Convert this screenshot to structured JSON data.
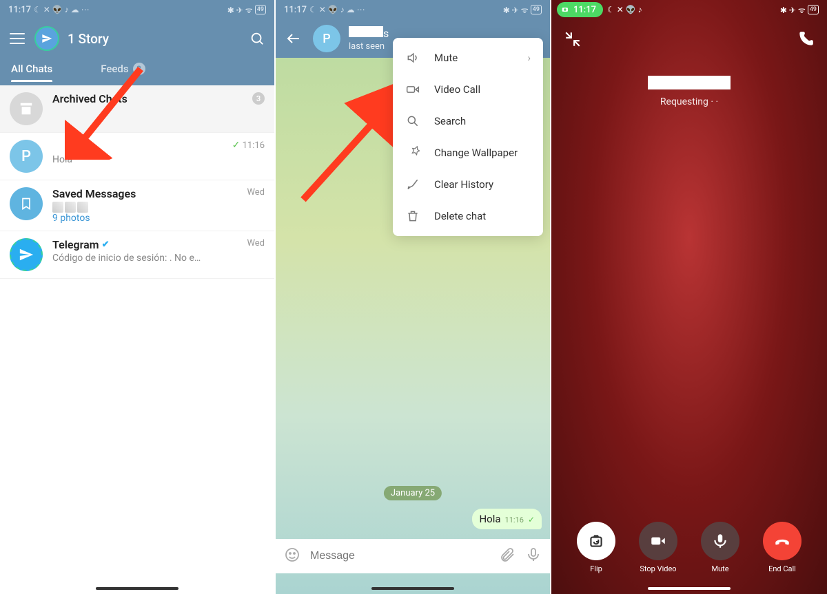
{
  "status": {
    "time": "11:17",
    "battery": "49",
    "icons_left": "☾ 🔕 👽 ♪ ☁ …",
    "icons_right": "✱ ✈ ᯤ"
  },
  "screen1": {
    "title": "1 Story",
    "tabs": {
      "allchats": "All Chats",
      "feeds": "Feeds",
      "feeds_badge": "3"
    },
    "archived": {
      "title": "Archived Chats",
      "badge": "3"
    },
    "chats": [
      {
        "avatar": "P",
        "title": "",
        "preview": "Hola",
        "time": "11:16"
      },
      {
        "title": "Saved Messages",
        "photos": "9 photos",
        "time": "Wed"
      },
      {
        "title": "Telegram",
        "preview": "Código de inicio de sesión:          . No e…",
        "time": "Wed"
      }
    ]
  },
  "screen2": {
    "contact_avatar": "P",
    "last_seen": "last seen",
    "menu": {
      "mute": "Mute",
      "video_call": "Video Call",
      "search": "Search",
      "change_wallpaper": "Change Wallpaper",
      "clear_history": "Clear History",
      "delete_chat": "Delete chat"
    },
    "date_chip": "January 25",
    "message": {
      "text": "Hola",
      "time": "11:16"
    },
    "input_placeholder": "Message"
  },
  "screen3": {
    "status_time": "11:17",
    "requesting": "Requesting · ·",
    "buttons": {
      "flip": "Flip",
      "stop_video": "Stop Video",
      "mute": "Mute",
      "end_call": "End Call"
    }
  }
}
